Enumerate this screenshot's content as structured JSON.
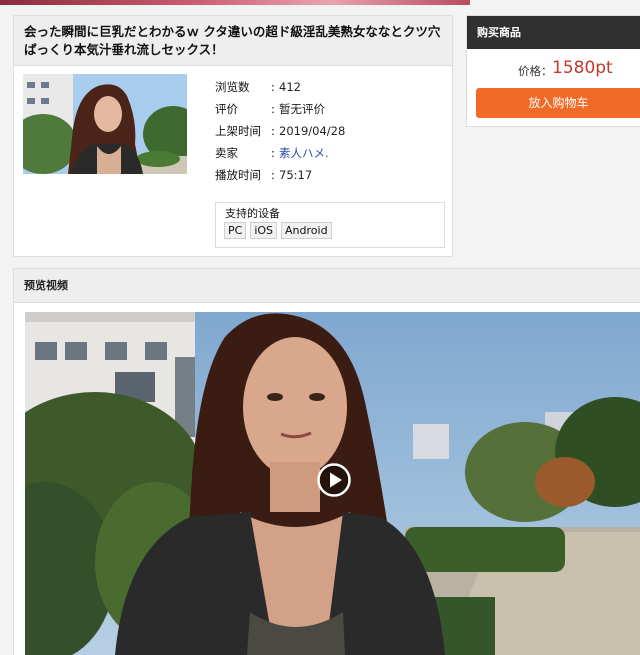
{
  "product": {
    "title": "会った瞬間に巨乳だとわかるｗ クタ違いの超ド級淫乱美熟女ななとクツ穴ぱっくり本気汁垂れ流しセックス！",
    "info": [
      {
        "label": "浏览数",
        "value": "412"
      },
      {
        "label": "评价",
        "value": "暂无评价"
      },
      {
        "label": "上架时间",
        "value": "2019/04/28"
      },
      {
        "label": "卖家",
        "value": "素人ハメ."
      },
      {
        "label": "播放时间",
        "value": "75:17"
      }
    ],
    "devices": {
      "title": "支持的设备",
      "list": [
        "PC",
        "iOS",
        "Android"
      ]
    }
  },
  "purchase": {
    "header": "购买商品",
    "price_label": "价格：",
    "price_value": "1580pt",
    "cart_button": "放入购物车"
  },
  "preview": {
    "header": "预览视频",
    "play_icon": "play-icon"
  },
  "colors": {
    "accent_orange": "#f26a28",
    "price_red": "#c0392b",
    "header_dark": "#303030",
    "seller_link": "#2a4fa8"
  }
}
